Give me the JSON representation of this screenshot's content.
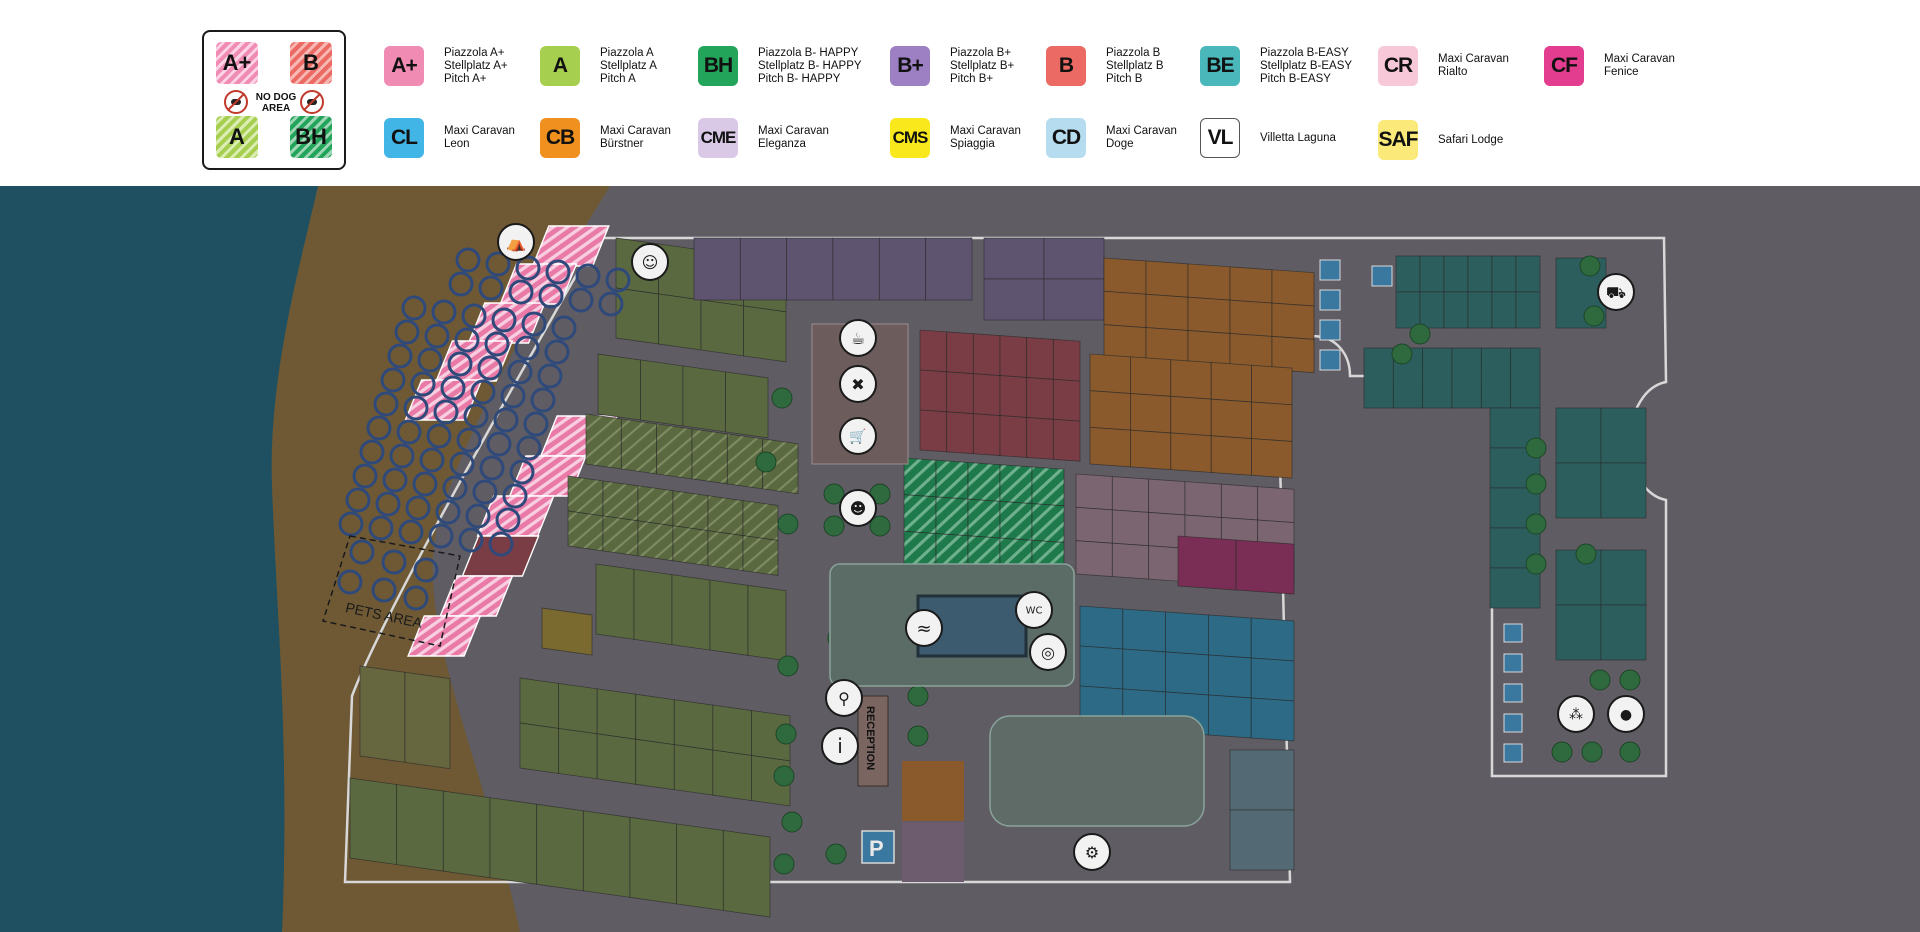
{
  "colors": {
    "sea": "#1e5062",
    "beach": "#6e5934",
    "ground": "#5f5d63",
    "road": "#666468",
    "outline": "#d8d8d8",
    "olive": "#5b6941",
    "purple": "#5f5470",
    "brown_orange": "#8a5a2c",
    "red": "#7a3d45",
    "green_hatched": "#1e7a4b",
    "mauve": "#7b6570",
    "magenta": "#7a2e55",
    "blue": "#2c6a86",
    "teal": "#2d5e5e",
    "pink_hatched": "#e97aa8",
    "tree": "#2e6a3e"
  },
  "no_dog_box": {
    "tiles": [
      "A+",
      "B",
      "A",
      "BH"
    ],
    "label_line1": "NO DOG",
    "label_line2": "AREA"
  },
  "legend": [
    {
      "code": "A+",
      "color": "#f08bb4",
      "lines": [
        "Piazzola A+",
        "Stellplatz A+",
        "Pitch A+"
      ]
    },
    {
      "code": "A",
      "color": "#a6cf4f",
      "lines": [
        "Piazzola A",
        "Stellplatz A",
        "Pitch A"
      ]
    },
    {
      "code": "BH",
      "color": "#22a45a",
      "lines": [
        "Piazzola B- HAPPY",
        "Stellplatz B- HAPPY",
        "Pitch B- HAPPY"
      ]
    },
    {
      "code": "B+",
      "color": "#9d80c4",
      "lines": [
        "Piazzola B+",
        "Stellplatz B+",
        "Pitch B+"
      ]
    },
    {
      "code": "B",
      "color": "#ec6a64",
      "lines": [
        "Piazzola B",
        "Stellplatz B",
        "Pitch B"
      ]
    },
    {
      "code": "BE",
      "color": "#4ab7bb",
      "lines": [
        "Piazzola B-EASY",
        "Stellplatz B-EASY",
        "Pitch B-EASY"
      ]
    },
    {
      "code": "CR",
      "color": "#f6c8d8",
      "lines": [
        "Maxi Caravan",
        "Rialto"
      ]
    },
    {
      "code": "CF",
      "color": "#e23d8e",
      "lines": [
        "Maxi Caravan",
        "Fenice"
      ]
    },
    {
      "code": "CL",
      "color": "#41b6e6",
      "lines": [
        "Maxi Caravan",
        "Leon"
      ]
    },
    {
      "code": "CB",
      "color": "#f0901e",
      "lines": [
        "Maxi Caravan",
        "Bürstner"
      ]
    },
    {
      "code": "CME",
      "color": "#d9c8e6",
      "lines": [
        "Maxi Caravan",
        "Eleganza"
      ]
    },
    {
      "code": "CMS",
      "color": "#f8e81c",
      "lines": [
        "Maxi Caravan",
        "Spiaggia"
      ]
    },
    {
      "code": "CD",
      "color": "#b6dcef",
      "lines": [
        "Maxi Caravan",
        "Doge"
      ]
    },
    {
      "code": "VL",
      "color": "#ffffff",
      "lines": [
        "Villetta Laguna"
      ]
    },
    {
      "code": "SAF",
      "color": "#fbe97a",
      "lines": [
        "Safari Lodge"
      ]
    }
  ],
  "map": {
    "pets_area_label": "PETS AREA",
    "reception_label": "RECEPTION",
    "parking_label": "P",
    "info_label": "i",
    "wc_label": "WC"
  }
}
